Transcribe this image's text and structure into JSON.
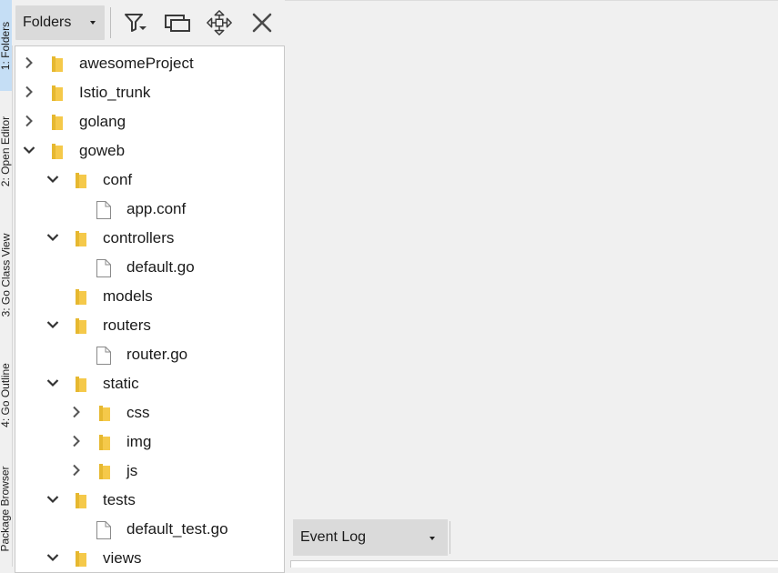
{
  "side_tabs": [
    {
      "label": "1: Folders",
      "active": true
    },
    {
      "label": "2: Open Editor",
      "active": false
    },
    {
      "label": "3: Go Class View",
      "active": false
    },
    {
      "label": "4: Go Outline",
      "active": false
    },
    {
      "label": "Package Browser",
      "active": false
    }
  ],
  "toolbar": {
    "folders_label": "Folders",
    "buttons": [
      "filter-icon",
      "windows-icon",
      "move-icon",
      "close-icon"
    ]
  },
  "tree": [
    {
      "label": "awesomeProject",
      "type": "folder",
      "depth": 0,
      "expanded": false
    },
    {
      "label": "Istio_trunk",
      "type": "folder",
      "depth": 0,
      "expanded": false
    },
    {
      "label": "golang",
      "type": "folder",
      "depth": 0,
      "expanded": false
    },
    {
      "label": "goweb",
      "type": "folder",
      "depth": 0,
      "expanded": true
    },
    {
      "label": "conf",
      "type": "folder",
      "depth": 1,
      "expanded": true
    },
    {
      "label": "app.conf",
      "type": "file",
      "depth": 2
    },
    {
      "label": "controllers",
      "type": "folder",
      "depth": 1,
      "expanded": true
    },
    {
      "label": "default.go",
      "type": "file",
      "depth": 2
    },
    {
      "label": "models",
      "type": "folder",
      "depth": 1,
      "expanded": null
    },
    {
      "label": "routers",
      "type": "folder",
      "depth": 1,
      "expanded": true
    },
    {
      "label": "router.go",
      "type": "file",
      "depth": 2
    },
    {
      "label": "static",
      "type": "folder",
      "depth": 1,
      "expanded": true
    },
    {
      "label": "css",
      "type": "folder",
      "depth": 2,
      "expanded": false
    },
    {
      "label": "img",
      "type": "folder",
      "depth": 2,
      "expanded": false
    },
    {
      "label": "js",
      "type": "folder",
      "depth": 2,
      "expanded": false
    },
    {
      "label": "tests",
      "type": "folder",
      "depth": 1,
      "expanded": true
    },
    {
      "label": "default_test.go",
      "type": "file",
      "depth": 2
    },
    {
      "label": "views",
      "type": "folder",
      "depth": 1,
      "expanded": true
    }
  ],
  "event_log": {
    "label": "Event Log"
  },
  "colors": {
    "active_tab": "#c5def5",
    "folder": "#f5c94a",
    "chevron": "#555555"
  }
}
